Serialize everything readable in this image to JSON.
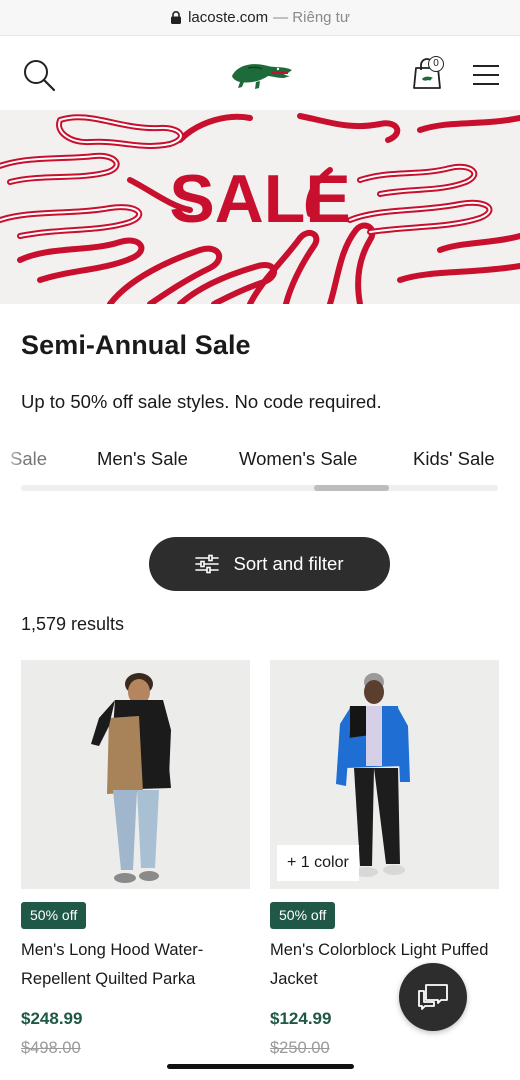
{
  "browser": {
    "domain": "lacoste.com",
    "privacy_label": "— Riêng tư"
  },
  "header": {
    "bag_count": "0",
    "logo": "lacoste-crocodile-logo"
  },
  "hero": {
    "text": "SALE",
    "accent": "#c8102e"
  },
  "page": {
    "title": "Semi-Annual Sale",
    "subtitle": "Up to 50% off sale styles. No code required."
  },
  "tabs": [
    {
      "label": "Sale"
    },
    {
      "label": "Men's Sale"
    },
    {
      "label": "Women's Sale"
    },
    {
      "label": "Kids' Sale"
    }
  ],
  "sort": {
    "label": "Sort and filter"
  },
  "results": {
    "count_text": "1,579 results"
  },
  "products": [
    {
      "badge": "50% off",
      "name": "Men's Long Hood Water-Repellent Quilted Parka",
      "price": "$248.99",
      "original_price": "$498.00",
      "color_tag": ""
    },
    {
      "badge": "50% off",
      "name": "Men's Colorblock Light Puffed Jacket",
      "price": "$124.99",
      "original_price": "$250.00",
      "color_tag": "+ 1 color"
    }
  ],
  "colors": {
    "brand_green": "#1f5847",
    "sale_red": "#c8102e",
    "button_dark": "#2d2d2d"
  }
}
